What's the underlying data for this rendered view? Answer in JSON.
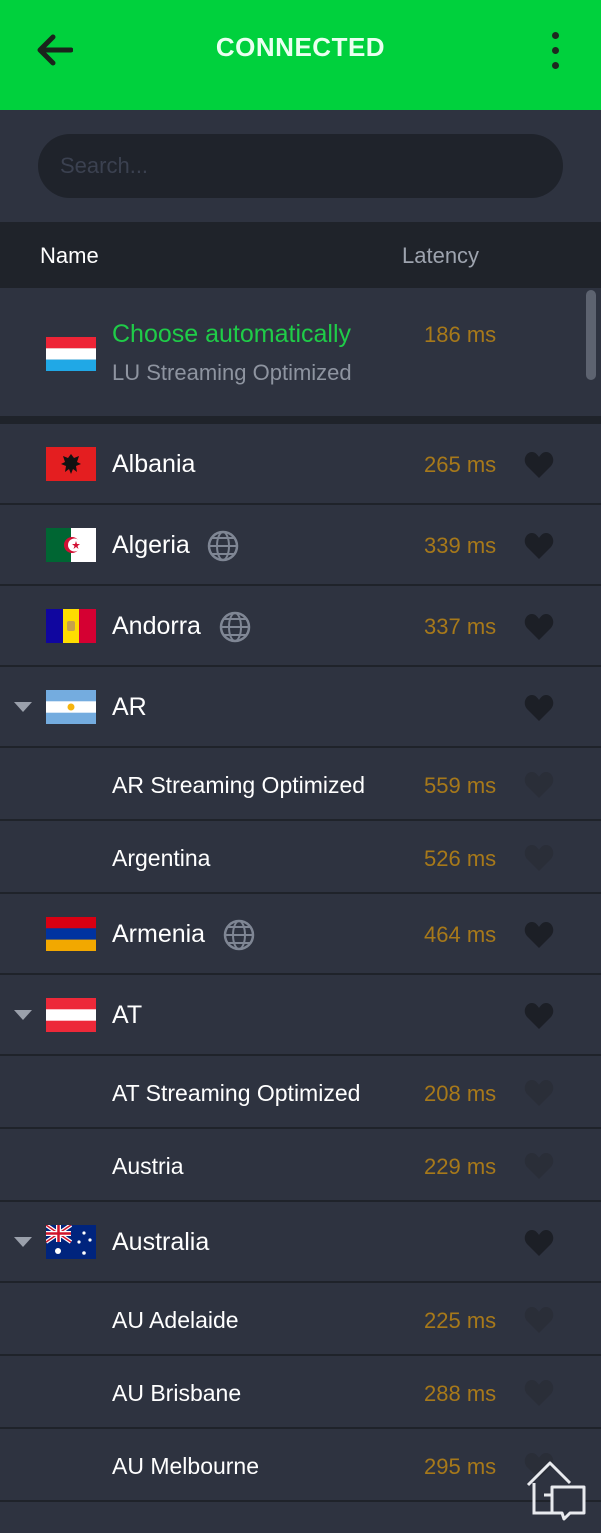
{
  "header": {
    "title": "CONNECTED",
    "accent": "#00d13d"
  },
  "search": {
    "placeholder": "Search..."
  },
  "columns": {
    "name": "Name",
    "latency": "Latency"
  },
  "auto": {
    "title": "Choose automatically",
    "subtitle": "LU Streaming Optimized",
    "latency": "186 ms",
    "flag": "luxembourg-flag-icon"
  },
  "rows": [
    {
      "label": "Albania",
      "latency": "265 ms",
      "flag": "albania-flag-icon"
    },
    {
      "label": "Algeria",
      "latency": "339 ms",
      "flag": "algeria-flag-icon",
      "globe": true
    },
    {
      "label": "Andorra",
      "latency": "337 ms",
      "flag": "andorra-flag-icon",
      "globe": true
    },
    {
      "label": "AR",
      "latency": "",
      "flag": "argentina-flag-icon",
      "group": true
    },
    {
      "label": "AR Streaming Optimized",
      "latency": "559 ms",
      "child": true
    },
    {
      "label": "Argentina",
      "latency": "526 ms",
      "child": true
    },
    {
      "label": "Armenia",
      "latency": "464 ms",
      "flag": "armenia-flag-icon",
      "globe": true
    },
    {
      "label": "AT",
      "latency": "",
      "flag": "austria-flag-icon",
      "group": true
    },
    {
      "label": "AT Streaming Optimized",
      "latency": "208 ms",
      "child": true
    },
    {
      "label": "Austria",
      "latency": "229 ms",
      "child": true
    },
    {
      "label": "Australia",
      "latency": "",
      "flag": "australia-flag-icon",
      "group": true
    },
    {
      "label": "AU Adelaide",
      "latency": "225 ms",
      "child": true
    },
    {
      "label": "AU Brisbane",
      "latency": "288 ms",
      "child": true
    },
    {
      "label": "AU Melbourne",
      "latency": "295 ms",
      "child": true
    }
  ]
}
